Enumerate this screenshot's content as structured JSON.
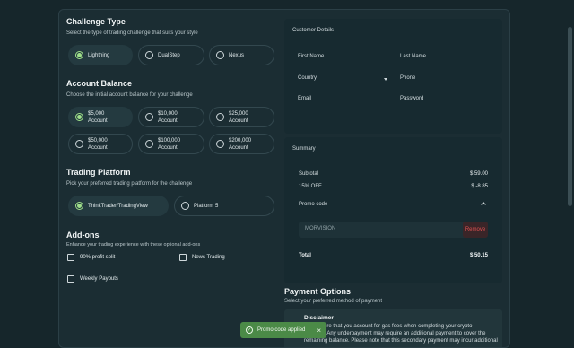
{
  "challenge": {
    "title": "Challenge Type",
    "subtitle": "Select the type of trading challenge that suits your style",
    "options": [
      "Lightning",
      "DualStep",
      "Nexus"
    ],
    "selected": "Lightning"
  },
  "balance": {
    "title": "Account Balance",
    "subtitle": "Choose the initial account balance for your challenge",
    "options": [
      {
        "amount": "$5,000",
        "unit": "Account"
      },
      {
        "amount": "$10,000",
        "unit": "Account"
      },
      {
        "amount": "$25,000",
        "unit": "Account"
      },
      {
        "amount": "$50,000",
        "unit": "Account"
      },
      {
        "amount": "$100,000",
        "unit": "Account"
      },
      {
        "amount": "$200,000",
        "unit": "Account"
      }
    ],
    "selected": "$5,000"
  },
  "platform": {
    "title": "Trading Platform",
    "subtitle": "Pick your preferred trading platform for the challenge",
    "options": [
      "ThinkTrader/TradingView",
      "Platform 5"
    ],
    "selected": "ThinkTrader/TradingView"
  },
  "addons": {
    "title": "Add-ons",
    "subtitle": "Enhance your trading experience with these optional add-ons",
    "items": [
      "90% profit split",
      "News Trading",
      "Weekly Payouts"
    ]
  },
  "customer": {
    "title": "Customer Details",
    "first_name": "First Name",
    "last_name": "Last Name",
    "country": "Country",
    "phone": "Phone",
    "email": "Email",
    "password": "Password"
  },
  "summary": {
    "title": "Summary",
    "subtotal_label": "Subtotal",
    "subtotal_value": "$ 59.00",
    "discount_label": "15% OFF",
    "discount_value": "$ -8.85",
    "promo_label": "Promo code",
    "promo_code": "MORVISION",
    "remove_label": "Remove",
    "total_label": "Total",
    "total_value": "$ 50.15"
  },
  "payment": {
    "title": "Payment Options",
    "subtitle": "Select your preferred method of payment",
    "disclaimer_title": "Disclaimer",
    "disclaimer_line1": "sure that you account for gas fees when completing your crypto",
    "disclaimer_line2": "n. Any underpayment may require an additional payment to cover the",
    "disclaimer_line3": "remaining balance. Please note that this secondary payment may incur additional"
  },
  "toast": {
    "message": "Promo code applied",
    "color": "#4b8a47"
  },
  "colors": {
    "accent": "#9fe08a",
    "remove": "#e05252"
  }
}
